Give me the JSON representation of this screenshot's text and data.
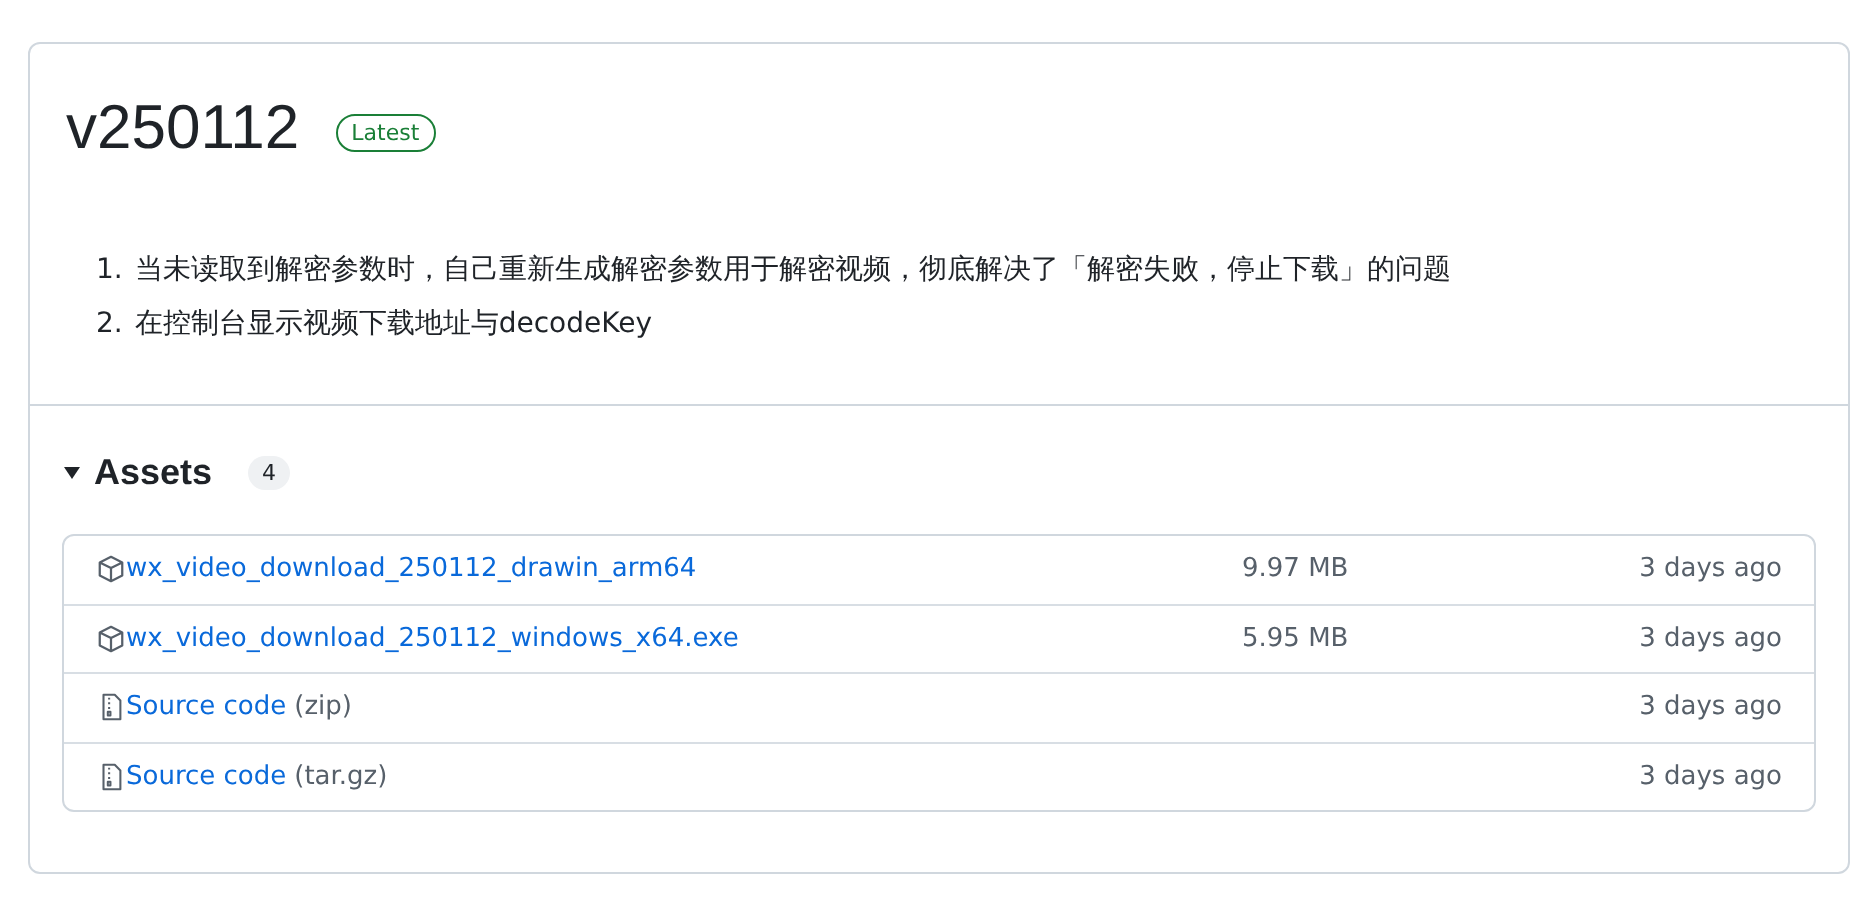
{
  "release": {
    "title": "v250112",
    "badge": "Latest"
  },
  "notes": [
    {
      "number": "1.",
      "text": "当未读取到解密参数时，自己重新生成解密参数用于解密视频，彻底解决了「解密失败，停止下载」的问题"
    },
    {
      "number": "2.",
      "text": "在控制台显示视频下载地址与decodeKey"
    }
  ],
  "assets": {
    "heading": "Assets",
    "expanded": true,
    "count": "4",
    "rows": [
      {
        "kind": "package",
        "name": "wx_video_download_250112_drawin_arm64",
        "size": "9.97 MB",
        "date": "3 days ago"
      },
      {
        "kind": "package",
        "name": "wx_video_download_250112_windows_x64.exe",
        "size": "5.95 MB",
        "date": "3 days ago"
      },
      {
        "kind": "archive",
        "name": "Source code",
        "suffix": "(zip)",
        "date": "3 days ago"
      },
      {
        "kind": "archive",
        "name": "Source code",
        "suffix": "(tar.gz)",
        "date": "3 days ago"
      }
    ]
  }
}
